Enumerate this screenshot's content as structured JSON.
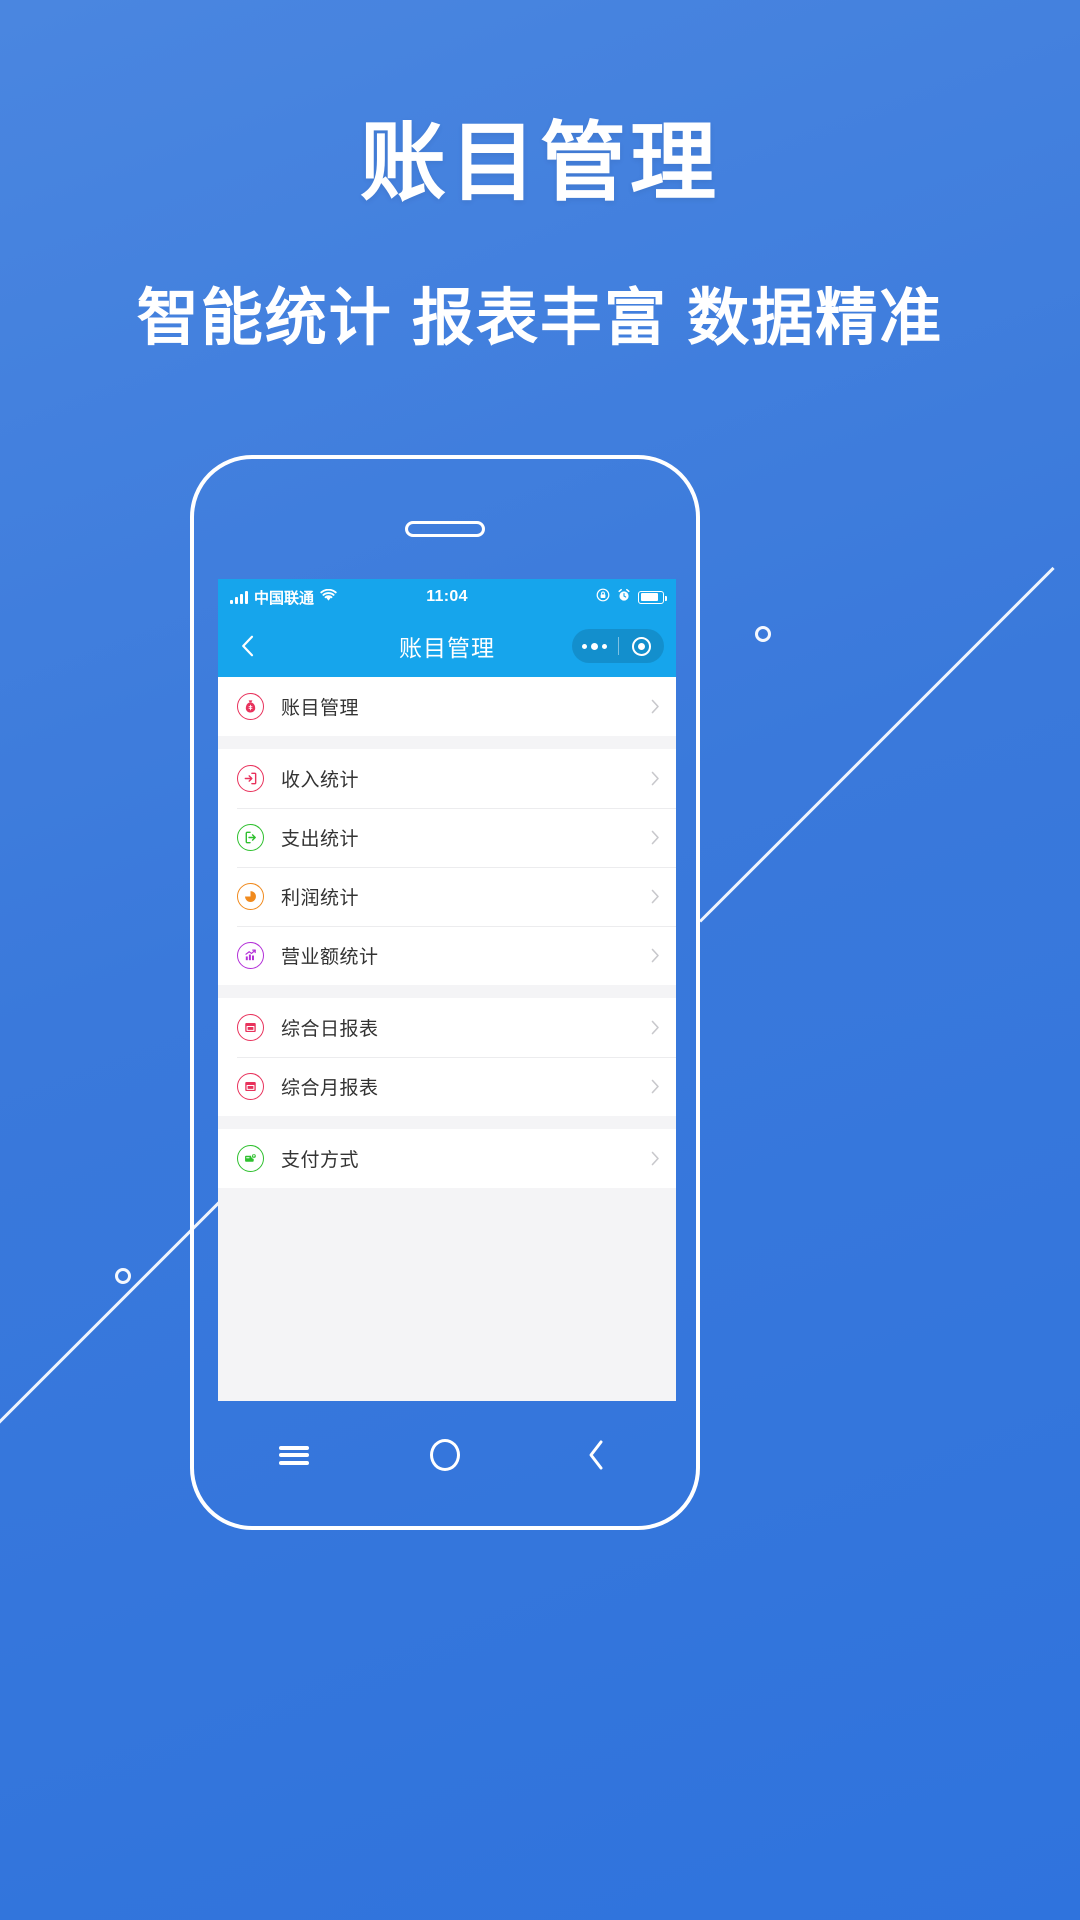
{
  "poster": {
    "headline": "账目管理",
    "subheadline": "智能统计 报表丰富 数据精准",
    "background_color": "#3a79db",
    "accent_color": "#16a5ec"
  },
  "phone": {
    "status_bar": {
      "carrier": "中国联通",
      "time": "11:04",
      "icons": [
        "signal-icon",
        "wifi-icon",
        "lock-rotation-icon",
        "alarm-icon",
        "battery-icon"
      ]
    },
    "nav_bar": {
      "back_icon": "chevron-left-icon",
      "title": "账目管理",
      "capsule": {
        "more_icon": "more-dots-icon",
        "target_icon": "target-circle-icon"
      }
    },
    "list_groups": [
      {
        "items": [
          {
            "label": "账目管理",
            "icon": "money-bag-icon",
            "color": "#e8325c",
            "chevron": "chevron-right-icon"
          }
        ]
      },
      {
        "items": [
          {
            "label": "收入统计",
            "icon": "arrow-into-box-icon",
            "color": "#e8325c",
            "chevron": "chevron-right-icon"
          },
          {
            "label": "支出统计",
            "icon": "arrow-out-of-box-icon",
            "color": "#2fc02f",
            "chevron": "chevron-right-icon"
          },
          {
            "label": "利润统计",
            "icon": "pie-chart-icon",
            "color": "#f08a1e",
            "chevron": "chevron-right-icon"
          },
          {
            "label": "营业额统计",
            "icon": "bar-chart-trend-icon",
            "color": "#b330d8",
            "chevron": "chevron-right-icon"
          }
        ]
      },
      {
        "items": [
          {
            "label": "综合日报表",
            "icon": "report-window-icon",
            "color": "#e8325c",
            "chevron": "chevron-right-icon"
          },
          {
            "label": "综合月报表",
            "icon": "report-window-icon",
            "color": "#e8325c",
            "chevron": "chevron-right-icon"
          }
        ]
      },
      {
        "items": [
          {
            "label": "支付方式",
            "icon": "payment-card-icon",
            "color": "#2fc02f",
            "chevron": "chevron-right-icon"
          }
        ]
      }
    ],
    "android_nav": {
      "menu_icon": "hamburger-menu-icon",
      "home_icon": "home-circle-icon",
      "back_icon": "chevron-left-icon"
    }
  }
}
